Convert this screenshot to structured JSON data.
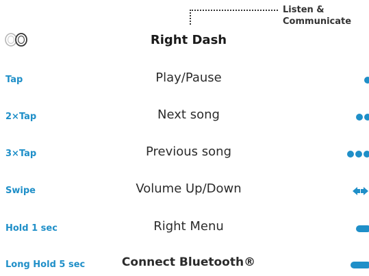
{
  "callout": {
    "label": "Listen &\nCommunicate"
  },
  "header": {
    "title": "Right Dash",
    "earbuds_icon": "earbuds-icon"
  },
  "colors": {
    "accent": "#1f8fc8",
    "text": "#2b2b2b"
  },
  "rows": [
    {
      "gesture": "Tap",
      "action": "Play/Pause",
      "icon": "single-tap-icon"
    },
    {
      "gesture": "2×Tap",
      "action": "Next song",
      "icon": "double-tap-icon"
    },
    {
      "gesture": "3×Tap",
      "action": "Previous song",
      "icon": "triple-tap-icon"
    },
    {
      "gesture": "Swipe",
      "action": "Volume Up/Down",
      "icon": "swipe-icon"
    },
    {
      "gesture": "Hold 1 sec",
      "action": "Right Menu",
      "icon": "hold-icon"
    },
    {
      "gesture": "Long Hold 5 sec",
      "action": "Connect Bluetooth®",
      "icon": "long-hold-icon"
    }
  ]
}
